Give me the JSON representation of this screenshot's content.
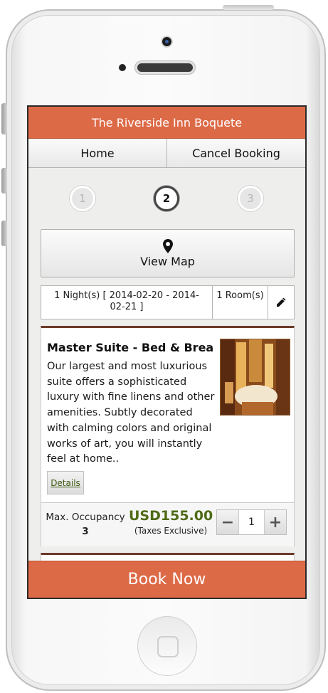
{
  "app": {
    "title": "The Riverside Inn Boquete"
  },
  "nav": {
    "home": "Home",
    "cancel": "Cancel Booking"
  },
  "steps": [
    "1",
    "2",
    "3"
  ],
  "active_step": "2",
  "map": {
    "label": "View Map",
    "icon": "map-pin-icon"
  },
  "booking": {
    "dates": "1 Night(s) [ 2014-02-20 - 2014-02-21 ]",
    "rooms": "1 Room(s)",
    "edit_icon": "pencil-icon"
  },
  "room": {
    "name": "Master Suite - Bed & Break...",
    "description": "Our largest and most luxurious suite offers a sophisticated luxury with fine linens and other amenities. Subtly decorated with calming colors and original works of art, you will instantly feel at home..",
    "details_label": "Details",
    "max_occupancy_label": "Max. Occupancy",
    "max_occupancy": "3",
    "price": "USD155.00",
    "tax_note": "(Taxes Exclusive)",
    "quantity": "1",
    "minus": "−",
    "plus": "+"
  },
  "footer": {
    "book_now": "Book Now"
  },
  "colors": {
    "accent": "#dd6a47",
    "price": "#4f6a16",
    "card_border": "#6b3b2c"
  }
}
